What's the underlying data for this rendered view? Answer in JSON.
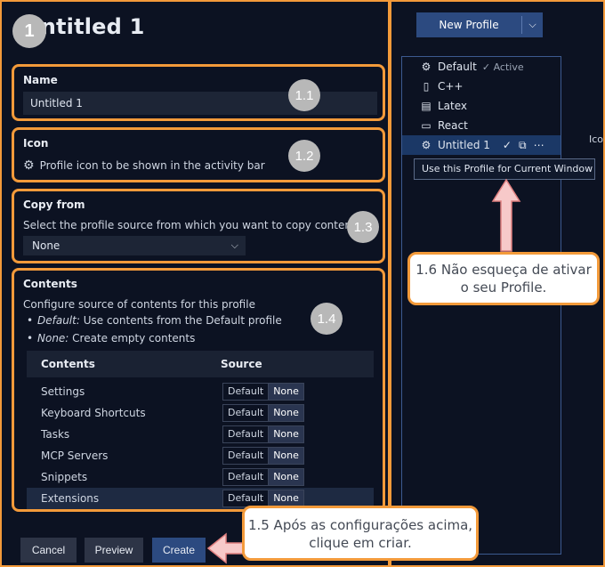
{
  "editor": {
    "title": "Untitled 1",
    "step_main": "1",
    "name": {
      "label": "Name",
      "value": "Untitled 1",
      "step": "1.1"
    },
    "icon": {
      "label": "Icon",
      "description": "Profile icon to be shown in the activity bar",
      "icon_name": "gear-icon",
      "step": "1.2"
    },
    "copy_from": {
      "label": "Copy from",
      "description": "Select the profile source from which you want to copy contents",
      "selected": "None",
      "step": "1.3"
    },
    "contents": {
      "label": "Contents",
      "description": "Configure source of contents for this profile",
      "bullets": [
        {
          "em": "Default:",
          "text": " Use contents from the Default profile"
        },
        {
          "em": "None:",
          "text": " Create empty contents"
        }
      ],
      "step": "1.4",
      "columns": [
        "Contents",
        "Source"
      ],
      "rows": [
        {
          "name": "Settings",
          "default": "Default",
          "none": "None"
        },
        {
          "name": "Keyboard Shortcuts",
          "default": "Default",
          "none": "None"
        },
        {
          "name": "Tasks",
          "default": "Default",
          "none": "None"
        },
        {
          "name": "MCP Servers",
          "default": "Default",
          "none": "None"
        },
        {
          "name": "Snippets",
          "default": "Default",
          "none": "None"
        },
        {
          "name": "Extensions",
          "default": "Default",
          "none": "None"
        }
      ]
    },
    "buttons": {
      "cancel": "Cancel",
      "preview": "Preview",
      "create": "Create"
    }
  },
  "callouts": {
    "create": "1.5 Após as configurações acima, clique em criar.",
    "activate": "1.6 Não esqueça de ativar o seu Profile."
  },
  "sidebar": {
    "new_profile": "New Profile",
    "profiles": [
      {
        "name": "Default",
        "icon": "gear-icon",
        "status": "Active"
      },
      {
        "name": "C++",
        "icon": "notebook-icon"
      },
      {
        "name": "Latex",
        "icon": "document-icon"
      },
      {
        "name": "React",
        "icon": "browser-icon"
      },
      {
        "name": "Untitled 1",
        "icon": "gear-icon"
      }
    ],
    "tooltip": "Use this Profile for Current Window",
    "edge_text": "Ico"
  },
  "colors": {
    "accent": "#f39a3a",
    "primary_button": "#2c4a80",
    "background": "#0c1222"
  }
}
